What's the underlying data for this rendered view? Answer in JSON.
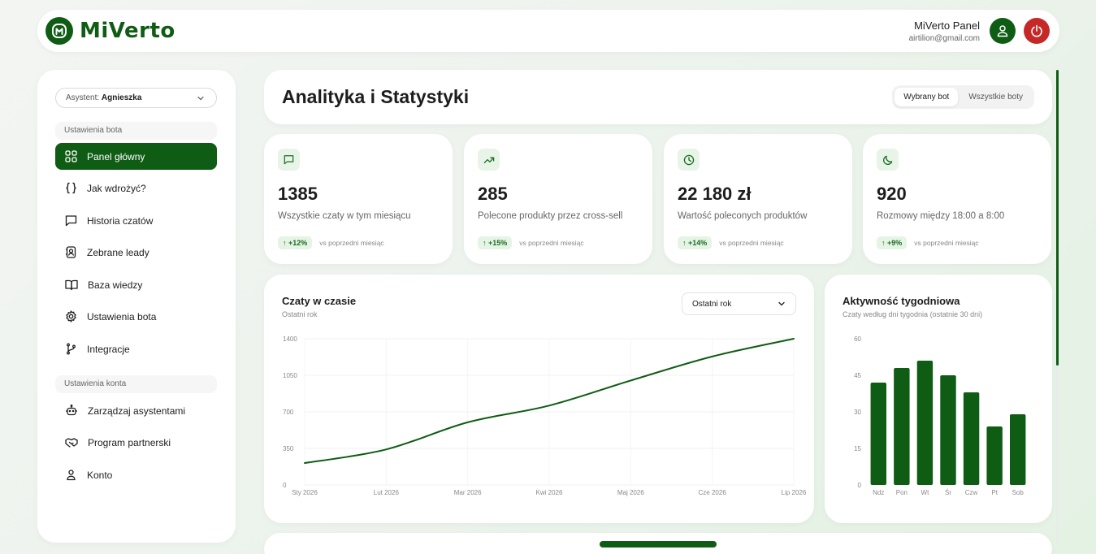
{
  "brand": {
    "name": "MiVerto",
    "accent": "#0f5c14",
    "danger": "#c62828"
  },
  "user": {
    "name": "MiVerto Panel",
    "email": "airtilion@gmail.com"
  },
  "sidebar": {
    "assistant_label": "Asystent:",
    "assistant_value": "Agnieszka",
    "section_bot": "Ustawienia bota",
    "section_account": "Ustawienia konta",
    "items": [
      {
        "label": "Panel główny",
        "icon": "grid-icon",
        "active": true
      },
      {
        "label": "Jak wdrożyć?",
        "icon": "code-braces-icon"
      },
      {
        "label": "Historia czatów",
        "icon": "chat-icon"
      },
      {
        "label": "Zebrane leady",
        "icon": "contact-icon"
      },
      {
        "label": "Baza wiedzy",
        "icon": "book-icon"
      },
      {
        "label": "Ustawienia bota",
        "icon": "gear-icon"
      },
      {
        "label": "Integracje",
        "icon": "branch-icon"
      }
    ],
    "account_items": [
      {
        "label": "Zarządzaj asystentami",
        "icon": "robot-icon"
      },
      {
        "label": "Program partnerski",
        "icon": "handshake-icon"
      },
      {
        "label": "Konto",
        "icon": "user-icon"
      }
    ]
  },
  "header": {
    "title": "Analityka i Statystyki",
    "toggle": [
      {
        "label": "Wybrany bot",
        "selected": true
      },
      {
        "label": "Wszystkie boty",
        "selected": false
      }
    ]
  },
  "stats": [
    {
      "value": "1385",
      "label": "Wszystkie czaty w tym miesiącu",
      "change": "+12%",
      "note": "vs poprzedni miesiąc",
      "icon": "chat-icon"
    },
    {
      "value": "285",
      "label": "Polecone produkty przez cross-sell",
      "change": "+15%",
      "note": "vs poprzedni miesiąc",
      "icon": "trend-up-icon"
    },
    {
      "value": "22 180 zł",
      "label": "Wartość poleconych produktów",
      "change": "+14%",
      "note": "vs poprzedni miesiąc",
      "icon": "clock-icon"
    },
    {
      "value": "920",
      "label": "Rozmowy między 18:00 a 8:00",
      "change": "+9%",
      "note": "vs poprzedni miesiąc",
      "icon": "moon-icon"
    }
  ],
  "chart_data": [
    {
      "type": "line",
      "title": "Czaty w czasie",
      "subtitle": "Ostatni rok",
      "period_select": "Ostatni rok",
      "x": [
        "Sty 2026",
        "Lut 2026",
        "Mar 2026",
        "Kwi 2026",
        "Maj 2026",
        "Cze 2026",
        "Lip 2026"
      ],
      "yticks": [
        0,
        350,
        700,
        1050,
        1400
      ],
      "ylim": [
        0,
        1400
      ],
      "series": [
        {
          "values": [
            210,
            340,
            600,
            760,
            1000,
            1230,
            1400
          ]
        }
      ],
      "color": "#0f5c14",
      "grid": true
    },
    {
      "type": "bar",
      "title": "Aktywność tygodniowa",
      "subtitle": "Czaty według dni tygodnia (ostatnie 30 dni)",
      "categories": [
        "Ndz",
        "Pon",
        "Wt",
        "Śr",
        "Czw",
        "Pt",
        "Sob"
      ],
      "values": [
        42,
        48,
        51,
        45,
        38,
        24,
        29
      ],
      "yticks": [
        0,
        15,
        30,
        45,
        60
      ],
      "ylim": [
        0,
        60
      ],
      "color": "#0f5c14",
      "grid": false
    }
  ]
}
